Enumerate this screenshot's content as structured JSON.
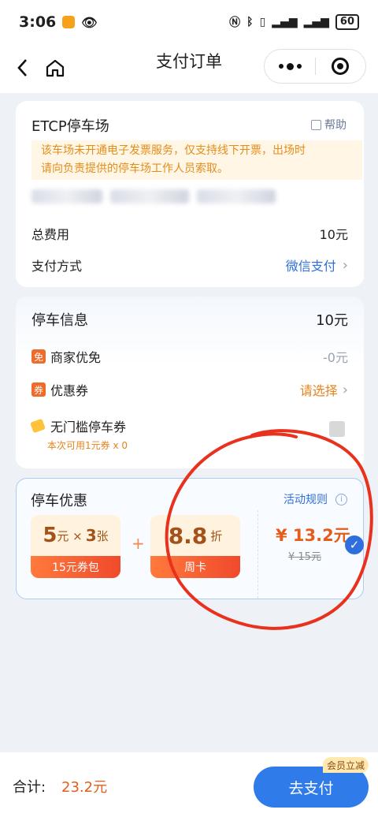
{
  "status_bar": {
    "time": "3:06",
    "battery": "60"
  },
  "nav": {
    "title": "支付订单"
  },
  "order_card": {
    "lot_name": "ETCP停车场",
    "help_label": "帮助",
    "notice_line1": "该车场未开通电子发票服务，仅支持线下开票，出场时",
    "notice_line2": "请向负责提供的停车场工作人员索取。",
    "total_fee_label": "总费用",
    "total_fee_value": "10元",
    "pay_method_label": "支付方式",
    "pay_method_value": "微信支付"
  },
  "parking_info": {
    "title": "停车信息",
    "amount": "10元",
    "merchant_tag": "免",
    "merchant_label": "商家优免",
    "merchant_value": "-0元",
    "coupon_tag": "券",
    "coupon_label": "优惠券",
    "coupon_value": "请选择",
    "threshold_label": "无门槛停车券",
    "threshold_note": "本次可用1元券 x 0"
  },
  "promo": {
    "title": "停车优惠",
    "rules_label": "活动规则",
    "pack1_num": "5",
    "pack1_unit1": "元 ×",
    "pack1_count": "3",
    "pack1_unit2": "张",
    "pack1_name": "15元券包",
    "plus": "+",
    "pack2_num": "8.8",
    "pack2_unit": "折",
    "pack2_name": "周卡",
    "price": "¥ 13.2元",
    "original_price": "¥ 15元"
  },
  "bottom": {
    "total_label": "合计:",
    "total_value": "23.2元",
    "pay_button": "去支付",
    "member_badge": "会员立减"
  },
  "colors": {
    "primary_blue": "#2f7bea",
    "accent_orange": "#e45d1b",
    "annotation_red": "#e8321e"
  }
}
